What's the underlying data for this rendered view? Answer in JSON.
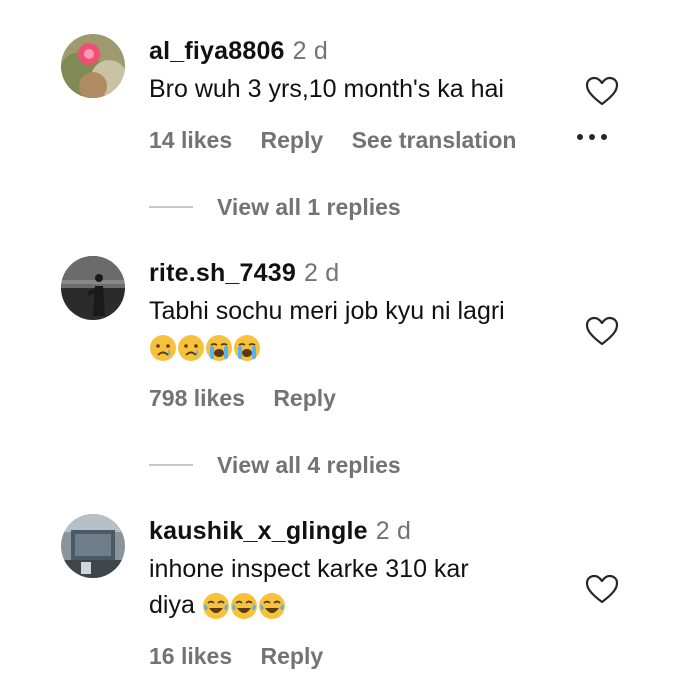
{
  "comments": [
    {
      "username": "al_fiya8806",
      "time": "2 d",
      "text_line1": "Bro wuh 3 yrs,10 month's ka hai",
      "text_line2": "",
      "likes": "14 likes",
      "reply_label": "Reply",
      "translate_label": "See translation",
      "view_replies": "View all 1 replies"
    },
    {
      "username": "rite.sh_7439",
      "time": "2 d",
      "text_line1": "Tabhi sochu meri job kyu ni lagri",
      "emojis": [
        "crying-face",
        "crying-face",
        "loudly-crying-face",
        "loudly-crying-face"
      ],
      "likes": "798 likes",
      "reply_label": "Reply",
      "view_replies": "View all 4 replies"
    },
    {
      "username": "kaushik_x_glingle",
      "time": "2 d",
      "text_line1": "inhone inspect karke 310 kar",
      "text_line2": "diya",
      "emojis": [
        "tears-of-joy",
        "tears-of-joy",
        "tears-of-joy"
      ],
      "likes": "16 likes",
      "reply_label": "Reply"
    }
  ],
  "colors": {
    "text": "#111111",
    "secondary": "#737373",
    "divider": "#c7c7c7",
    "emoji_yellow": "#f7c23b"
  }
}
